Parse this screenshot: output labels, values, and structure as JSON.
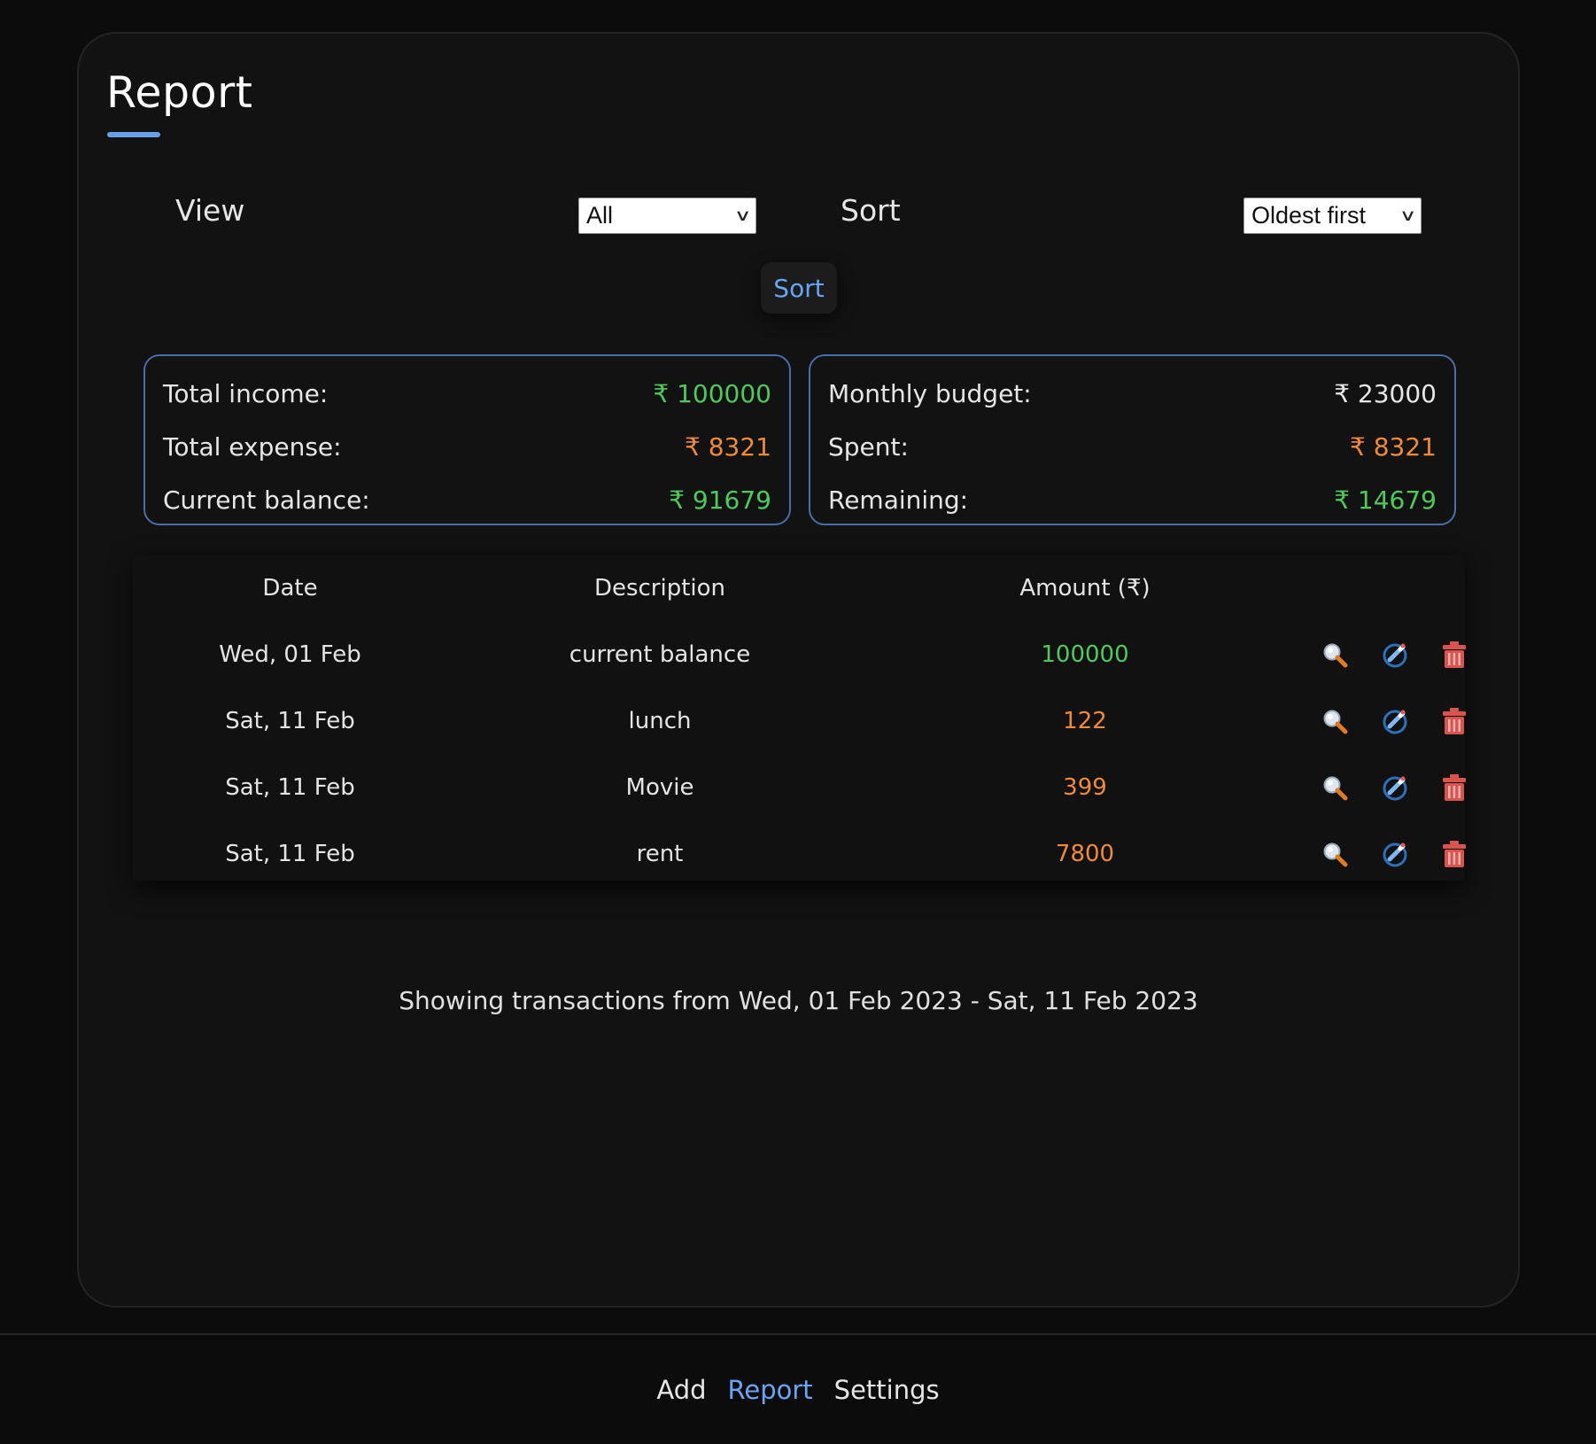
{
  "page": {
    "title": "Report"
  },
  "controls": {
    "view_label": "View",
    "view_value": "All",
    "sort_label": "Sort",
    "sort_value": "Oldest first",
    "sort_button": "Sort"
  },
  "summary_left": [
    {
      "label": "Total income:",
      "value": "₹ 100000",
      "color": "green"
    },
    {
      "label": "Total expense:",
      "value": "₹ 8321",
      "color": "orange"
    },
    {
      "label": "Current balance:",
      "value": "₹ 91679",
      "color": "green"
    }
  ],
  "summary_right": [
    {
      "label": "Monthly budget:",
      "value": "₹ 23000",
      "color": "white"
    },
    {
      "label": "Spent:",
      "value": "₹ 8321",
      "color": "orange"
    },
    {
      "label": "Remaining:",
      "value": "₹ 14679",
      "color": "green"
    }
  ],
  "table": {
    "headers": {
      "date": "Date",
      "description": "Description",
      "amount": "Amount (₹)"
    },
    "rows": [
      {
        "date": "Wed, 01 Feb",
        "description": "current balance",
        "amount": "100000",
        "color": "green"
      },
      {
        "date": "Sat, 11 Feb",
        "description": "lunch",
        "amount": "122",
        "color": "orange"
      },
      {
        "date": "Sat, 11 Feb",
        "description": "Movie",
        "amount": "399",
        "color": "orange"
      },
      {
        "date": "Sat, 11 Feb",
        "description": "rent",
        "amount": "7800",
        "color": "orange"
      }
    ],
    "action_icons": [
      "magnifier-icon",
      "pencil-edit-icon",
      "trash-icon"
    ]
  },
  "range_text": "Showing transactions from Wed, 01 Feb 2023 - Sat, 11 Feb 2023",
  "nav": {
    "add": "Add",
    "report": "Report",
    "settings": "Settings"
  },
  "colors": {
    "accent": "#6aa4f4",
    "green": "#4fc95a",
    "orange": "#f08a3a",
    "border": "#4a6da8",
    "delete": "#d9534f"
  }
}
